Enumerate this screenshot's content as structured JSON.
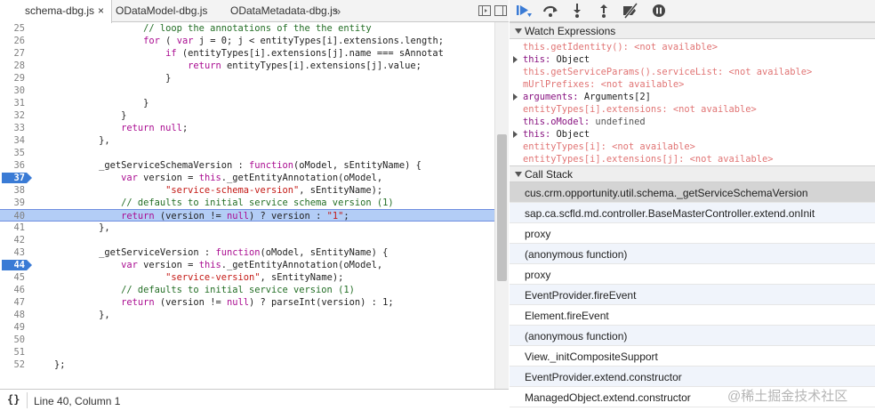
{
  "tabs": [
    {
      "label": "schema-dbg.js",
      "active": true
    },
    {
      "label": "ODataModel-dbg.js",
      "active": false
    },
    {
      "label": "ODataMetadata-dbg.js",
      "active": false
    }
  ],
  "tab_close_glyph": "×",
  "tab_overflow_glyph": "»",
  "code_lines": [
    {
      "n": "25",
      "text": "                    // loop the annotations of the the entity",
      "cls": "cm"
    },
    {
      "n": "26",
      "html": "                    <span class='kw'>for</span> ( <span class='kw'>var</span> j = 0; j &lt; entityTypes[i].extensions.length;"
    },
    {
      "n": "27",
      "html": "                        <span class='kw'>if</span> (entityTypes[i].extensions[j].name === sAnnotat"
    },
    {
      "n": "28",
      "html": "                            <span class='kw'>return</span> entityTypes[i].extensions[j].value;"
    },
    {
      "n": "29",
      "text": "                        }"
    },
    {
      "n": "30",
      "text": ""
    },
    {
      "n": "31",
      "text": "                    }"
    },
    {
      "n": "32",
      "text": "                }"
    },
    {
      "n": "33",
      "html": "                <span class='kw'>return</span> <span class='kw'>null</span>;"
    },
    {
      "n": "34",
      "text": "            },"
    },
    {
      "n": "35",
      "text": ""
    },
    {
      "n": "36",
      "html": "            _getServiceSchemaVersion : <span class='kw'>function</span>(oModel, sEntityName) {"
    },
    {
      "n": "37",
      "bp": true,
      "html": "                <span class='kw'>var</span> version = <span class='kw'>this</span>._getEntityAnnotation(oModel,"
    },
    {
      "n": "38",
      "html": "                        <span class='str'>\"service-schema-version\"</span>, sEntityName);"
    },
    {
      "n": "39",
      "html": "                <span class='cm'>// defaults to initial service schema version (1)</span>"
    },
    {
      "n": "40",
      "hl": true,
      "html": "                <span class='kw'>return</span> (version != <span class='kw'>null</span>) ? version : <span class='str'>\"1\"</span>;"
    },
    {
      "n": "41",
      "text": "            },"
    },
    {
      "n": "42",
      "text": ""
    },
    {
      "n": "43",
      "html": "            _getServiceVersion : <span class='kw'>function</span>(oModel, sEntityName) {"
    },
    {
      "n": "44",
      "bp": true,
      "html": "                <span class='kw'>var</span> version = <span class='kw'>this</span>._getEntityAnnotation(oModel,"
    },
    {
      "n": "45",
      "html": "                        <span class='str'>\"service-version\"</span>, sEntityName);"
    },
    {
      "n": "46",
      "html": "                <span class='cm'>// defaults to initial service version (1)</span>"
    },
    {
      "n": "47",
      "html": "                <span class='kw'>return</span> (version != <span class='kw'>null</span>) ? parseInt(version) : 1;"
    },
    {
      "n": "48",
      "text": "            },"
    },
    {
      "n": "49",
      "text": ""
    },
    {
      "n": "50",
      "text": ""
    },
    {
      "n": "51",
      "text": ""
    },
    {
      "n": "52",
      "text": "    };"
    }
  ],
  "status": {
    "pretty_print_glyph": "{}",
    "position": "Line 40, Column 1"
  },
  "watch": {
    "title": "Watch Expressions",
    "items": [
      {
        "expandable": false,
        "name": "this.getIdentity()",
        "sep": ": ",
        "value": "<not available>",
        "kind": "na"
      },
      {
        "expandable": true,
        "name": "this",
        "sep": ": ",
        "value": "Object",
        "kind": "ok"
      },
      {
        "expandable": false,
        "name": "this.getServiceParams().serviceList",
        "sep": ": ",
        "value": "<not available>",
        "kind": "na"
      },
      {
        "expandable": false,
        "name": "mUrlPrefixes",
        "sep": ": ",
        "value": "<not available>",
        "kind": "na"
      },
      {
        "expandable": true,
        "name": "arguments",
        "sep": ": ",
        "value": "Arguments[2]",
        "kind": "ok"
      },
      {
        "expandable": false,
        "name": "entityTypes[i].extensions",
        "sep": ": ",
        "value": "<not available>",
        "kind": "na"
      },
      {
        "expandable": false,
        "name": "this.oModel",
        "sep": ": ",
        "value": "undefined",
        "kind": "undef"
      },
      {
        "expandable": true,
        "name": "this",
        "sep": ": ",
        "value": "Object",
        "kind": "ok"
      },
      {
        "expandable": false,
        "name": "entityTypes[i]",
        "sep": ": ",
        "value": "<not available>",
        "kind": "na"
      },
      {
        "expandable": false,
        "name": "entityTypes[i].extensions[j]",
        "sep": ": ",
        "value": "<not available>",
        "kind": "na"
      }
    ]
  },
  "callstack": {
    "title": "Call Stack",
    "frames": [
      "cus.crm.opportunity.util.schema._getServiceSchemaVersion",
      "sap.ca.scfld.md.controller.BaseMasterController.extend.onInit",
      "proxy",
      "(anonymous function)",
      "proxy",
      "EventProvider.fireEvent",
      "Element.fireEvent",
      "(anonymous function)",
      "View._initCompositeSupport",
      "EventProvider.extend.constructor",
      "ManagedObject.extend.constructor"
    ]
  },
  "watermark": "@稀土掘金技术社区",
  "colors": {
    "accent": "#3a7bd5",
    "highlight": "#b3cdf6",
    "keyword": "#aa0d91",
    "string": "#c41a16",
    "comment": "#236e25"
  }
}
